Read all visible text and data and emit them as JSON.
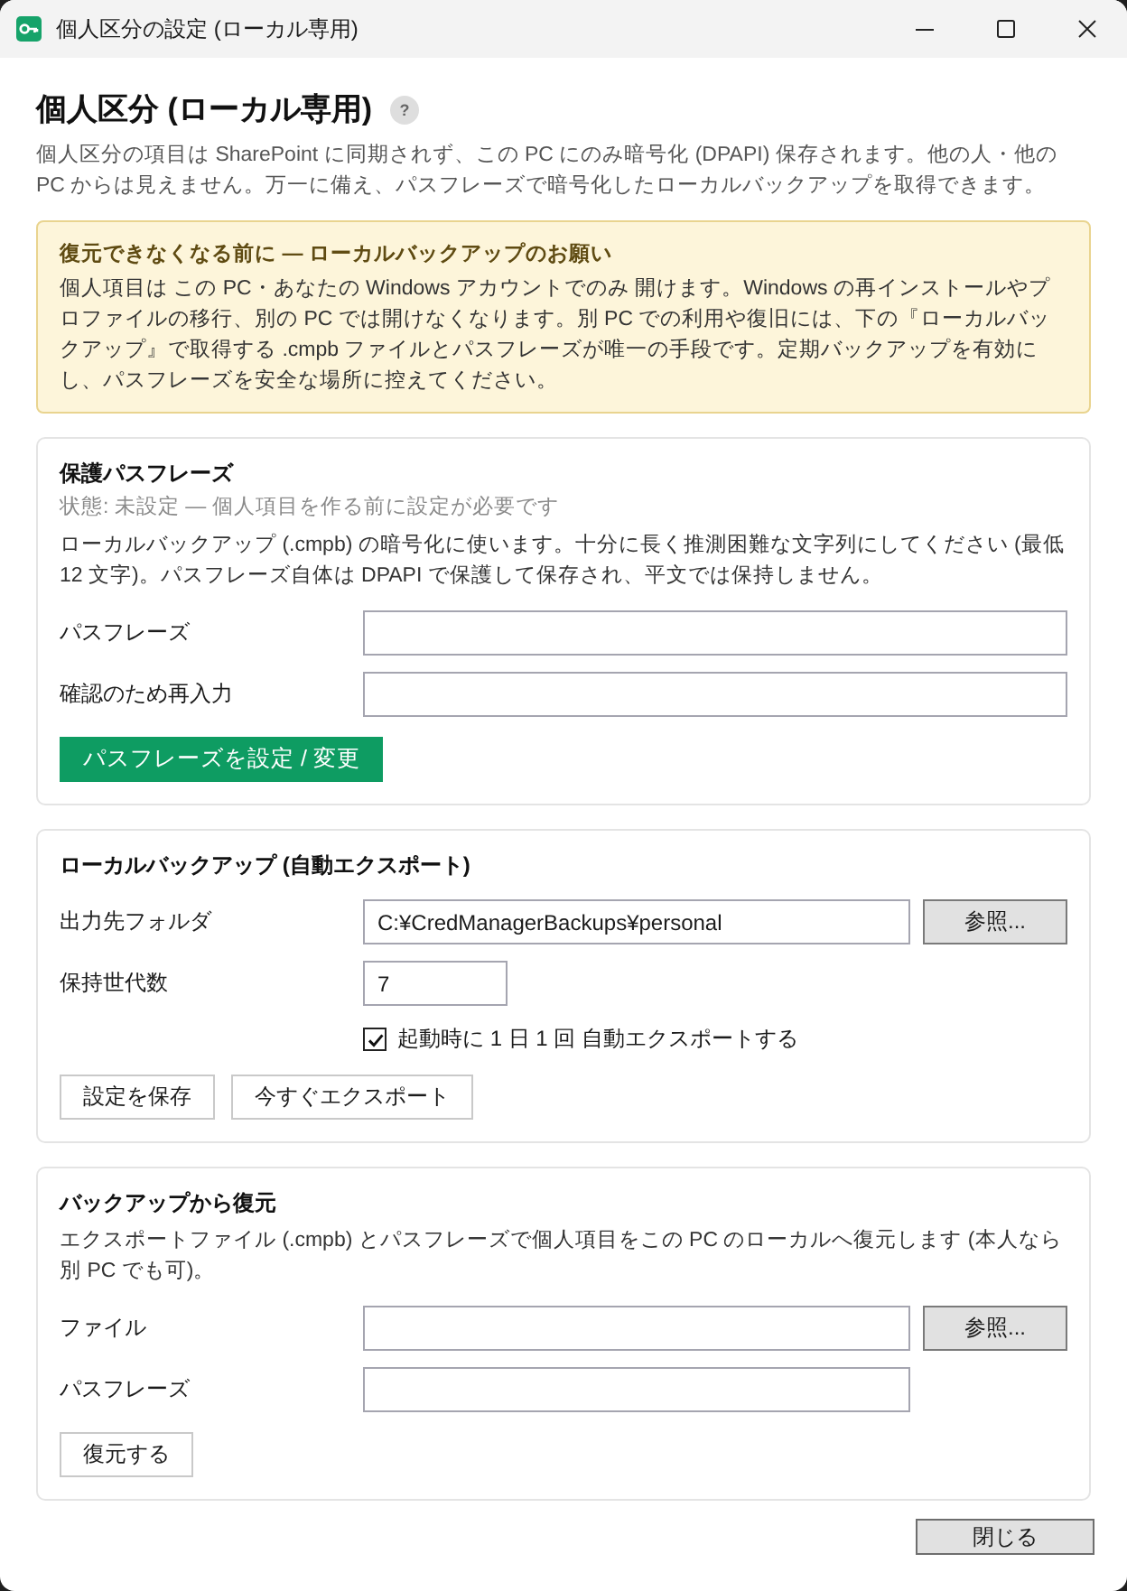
{
  "window": {
    "title": "個人区分の設定 (ローカル専用)"
  },
  "header": {
    "title": "個人区分 (ローカル専用)",
    "help": "?",
    "description": "個人区分の項目は SharePoint に同期されず、この PC にのみ暗号化 (DPAPI) 保存されます。他の人・他の PC からは見えません。万一に備え、パスフレーズで暗号化したローカルバックアップを取得できます。"
  },
  "warning": {
    "title": "復元できなくなる前に — ローカルバックアップのお願い",
    "text": "個人項目は この PC・あなたの Windows アカウントでのみ 開けます。Windows の再インストールやプロファイルの移行、別の PC では開けなくなります。別 PC での利用や復旧には、下の『ローカルバックアップ』で取得する .cmpb ファイルとパスフレーズが唯一の手段です。定期バックアップを有効にし、パスフレーズを安全な場所に控えてください。"
  },
  "sections": [
    {
      "title": "保護パスフレーズ",
      "status": "状態: 未設定 — 個人項目を作る前に設定が必要です",
      "description": "ローカルバックアップ (.cmpb) の暗号化に使います。十分に長く推測困難な文字列にしてください (最低 12 文字)。パスフレーズ自体は DPAPI で保護して保存され、平文では保持しません。",
      "fields": [
        {
          "label": "パスフレーズ",
          "kind": "text"
        },
        {
          "label": "確認のため再入力",
          "kind": "text"
        }
      ],
      "buttons": [
        {
          "label": "パスフレーズを設定 / 変更",
          "kind": "primary"
        }
      ]
    },
    {
      "title": "ローカルバックアップ (自動エクスポート)",
      "fields": [
        {
          "label": "出力先フォルダ",
          "kind": "text",
          "value": "C:¥CredManagerBackups¥personal",
          "browse": "参照..."
        },
        {
          "label": "保持世代数",
          "kind": "short",
          "value": "7"
        }
      ],
      "checkbox": {
        "label": "起動時に 1 日 1 回 自動エクスポートする",
        "checked": true
      },
      "buttons": [
        {
          "label": "設定を保存",
          "kind": "secondary"
        },
        {
          "label": "今すぐエクスポート",
          "kind": "secondary"
        }
      ]
    },
    {
      "title": "バックアップから復元",
      "description": "エクスポートファイル (.cmpb) とパスフレーズで個人項目をこの PC のローカルへ復元します (本人なら別 PC でも可)。",
      "fields": [
        {
          "label": "ファイル",
          "kind": "text",
          "browse": "参照..."
        },
        {
          "label": "パスフレーズ",
          "kind": "text"
        }
      ],
      "buttons": [
        {
          "label": "復元する",
          "kind": "secondary"
        }
      ]
    }
  ],
  "footer": {
    "close_button": "閉じる"
  }
}
